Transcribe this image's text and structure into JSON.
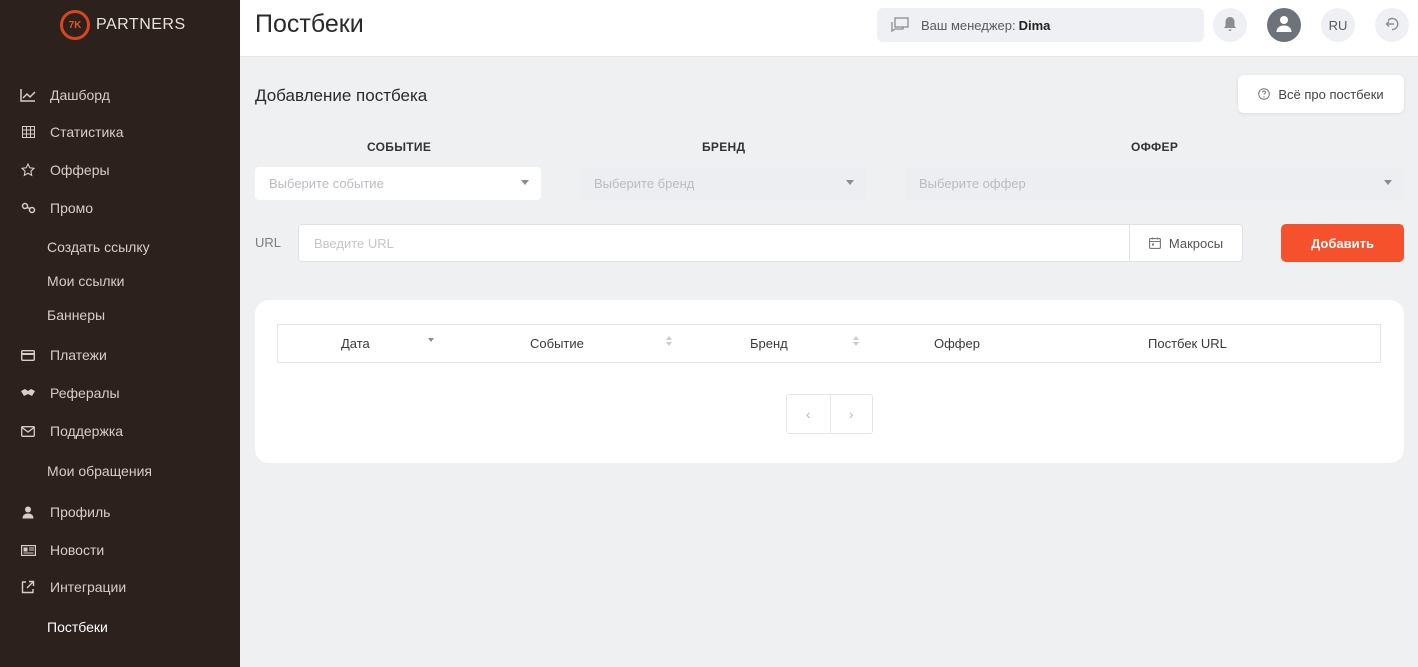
{
  "brand": {
    "logo_mark": "7K",
    "logo_text": "PARTNERS",
    "accent": "#f4512c"
  },
  "sidebar": {
    "items": [
      {
        "label": "Дашборд",
        "icon": "chart-line-icon"
      },
      {
        "label": "Статистика",
        "icon": "grid-table-icon"
      },
      {
        "label": "Офферы",
        "icon": "star-icon"
      },
      {
        "label": "Промо",
        "icon": "link-icon"
      },
      {
        "label": "Создать ссылку"
      },
      {
        "label": "Мои ссылки"
      },
      {
        "label": "Баннеры"
      },
      {
        "label": "Платежи",
        "icon": "credit-card-icon"
      },
      {
        "label": "Рефералы",
        "icon": "handshake-icon"
      },
      {
        "label": "Поддержка",
        "icon": "mail-icon"
      },
      {
        "label": "Мои обращения"
      },
      {
        "label": "Профиль",
        "icon": "user-icon"
      },
      {
        "label": "Новости",
        "icon": "news-icon"
      },
      {
        "label": "Интеграции",
        "icon": "share-icon"
      },
      {
        "label": "Постбеки",
        "active": true
      }
    ]
  },
  "header": {
    "title": "Постбеки",
    "manager_label": "Ваш менеджер:",
    "manager_name": "Dima",
    "lang": "RU"
  },
  "form": {
    "title": "Добавление постбека",
    "help_label": "Всё про постбеки",
    "event_label": "СОБЫТИЕ",
    "event_placeholder": "Выберите событие",
    "brand_label": "БРЕНД",
    "brand_placeholder": "Выберите бренд",
    "offer_label": "ОФФЕР",
    "offer_placeholder": "Выберите оффер",
    "url_label": "URL",
    "url_placeholder": "Введите URL",
    "macros_label": "Макросы",
    "add_label": "Добавить"
  },
  "table": {
    "columns": [
      "Дата",
      "Событие",
      "Бренд",
      "Оффер",
      "Постбек URL"
    ],
    "rows": []
  },
  "pager": {
    "prev": "‹",
    "next": "›"
  }
}
